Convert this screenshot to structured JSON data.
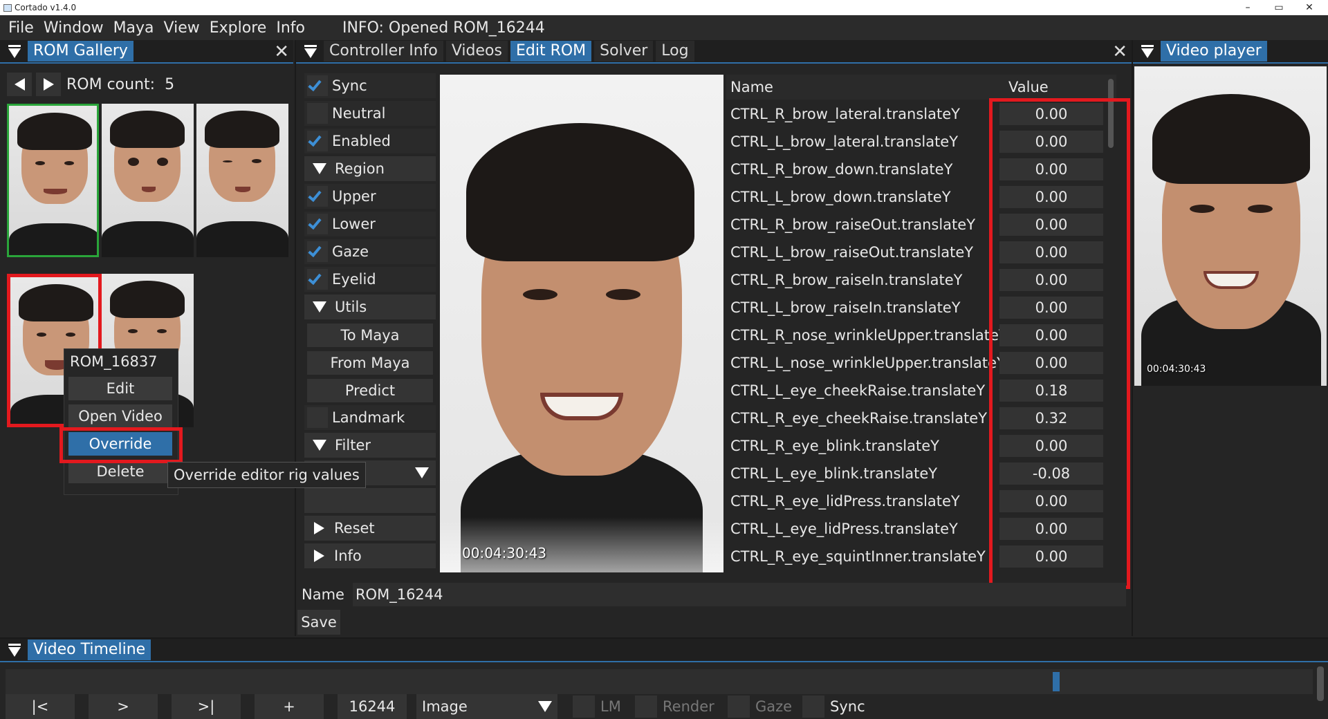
{
  "window": {
    "title": "Cortado v1.4.0",
    "minimize": "–",
    "maximize": "▭",
    "close": "✕"
  },
  "menubar": {
    "items": [
      "File",
      "Window",
      "Maya",
      "View",
      "Explore",
      "Info"
    ],
    "status": "INFO: Opened ROM_16244"
  },
  "rom_gallery": {
    "tab": "ROM Gallery",
    "rom_count_label": "ROM count:",
    "rom_count": "5",
    "context_menu": {
      "title": "ROM_16837",
      "items": [
        "Edit",
        "Open Video",
        "Override",
        "Delete"
      ],
      "highlighted": "Override",
      "tooltip": "Override editor rig values"
    }
  },
  "center_tabs": [
    "Controller Info",
    "Videos",
    "Edit ROM",
    "Solver",
    "Log"
  ],
  "active_tab": "Edit ROM",
  "edit_rom": {
    "options": [
      {
        "label": "Sync",
        "checked": true
      },
      {
        "label": "Neutral",
        "checked": false
      },
      {
        "label": "Enabled",
        "checked": true
      }
    ],
    "region": {
      "label": "Region",
      "items": [
        {
          "label": "Upper",
          "checked": true
        },
        {
          "label": "Lower",
          "checked": true
        },
        {
          "label": "Gaze",
          "checked": true
        },
        {
          "label": "Eyelid",
          "checked": true
        }
      ]
    },
    "utils": {
      "label": "Utils",
      "buttons": [
        "To Maya",
        "From Maya",
        "Predict",
        "Landmark"
      ]
    },
    "filter": {
      "label": "Filter",
      "select_value": ""
    },
    "reset": "Reset",
    "info": "Info",
    "video_timestamp": "00:04:30:43",
    "name_label": "Name",
    "name_value": "ROM_16244",
    "save": "Save"
  },
  "table": {
    "headers": [
      "Name",
      "Value"
    ],
    "rows": [
      {
        "name": "CTRL_R_brow_lateral.translateY",
        "value": "0.00"
      },
      {
        "name": "CTRL_L_brow_lateral.translateY",
        "value": "0.00"
      },
      {
        "name": "CTRL_R_brow_down.translateY",
        "value": "0.00"
      },
      {
        "name": "CTRL_L_brow_down.translateY",
        "value": "0.00"
      },
      {
        "name": "CTRL_R_brow_raiseOut.translateY",
        "value": "0.00"
      },
      {
        "name": "CTRL_L_brow_raiseOut.translateY",
        "value": "0.00"
      },
      {
        "name": "CTRL_R_brow_raiseIn.translateY",
        "value": "0.00"
      },
      {
        "name": "CTRL_L_brow_raiseIn.translateY",
        "value": "0.00"
      },
      {
        "name": "CTRL_R_nose_wrinkleUpper.translateY",
        "value": "0.00"
      },
      {
        "name": "CTRL_L_nose_wrinkleUpper.translateY",
        "value": "0.00"
      },
      {
        "name": "CTRL_L_eye_cheekRaise.translateY",
        "value": "0.18"
      },
      {
        "name": "CTRL_R_eye_cheekRaise.translateY",
        "value": "0.32"
      },
      {
        "name": "CTRL_R_eye_blink.translateY",
        "value": "0.00"
      },
      {
        "name": "CTRL_L_eye_blink.translateY",
        "value": "-0.08"
      },
      {
        "name": "CTRL_R_eye_lidPress.translateY",
        "value": "0.00"
      },
      {
        "name": "CTRL_L_eye_lidPress.translateY",
        "value": "0.00"
      },
      {
        "name": "CTRL_R_eye_squintInner.translateY",
        "value": "0.00"
      }
    ]
  },
  "video_player": {
    "tab": "Video player",
    "timestamp": "00:04:30:43"
  },
  "timeline": {
    "tab": "Video Timeline",
    "buttons": [
      "|<",
      ">",
      ">|",
      "+"
    ],
    "frame": "16244",
    "mode": "Image",
    "toggles": [
      "LM",
      "Render",
      "Gaze",
      "Sync"
    ]
  },
  "colors": {
    "accent": "#2f6fa8",
    "highlight_red": "#e3191e",
    "selected_green": "#2aa53a"
  }
}
